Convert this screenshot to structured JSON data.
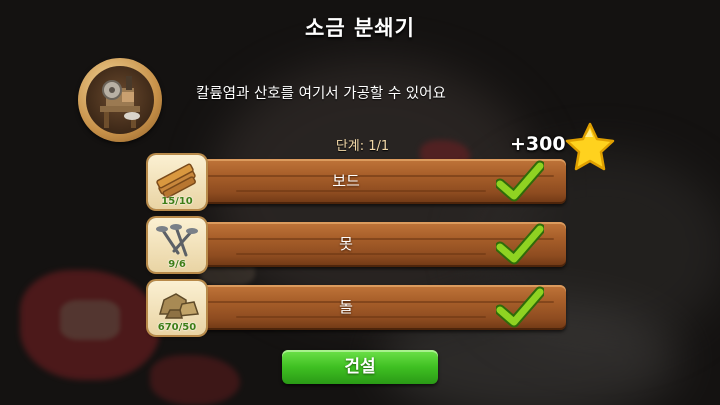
{
  "dialog": {
    "title": "소금 분쇄기",
    "description": "칼륨염과 산호를 여기서 가공할 수 있어요",
    "stage_label": "단계: 1/1",
    "reward": "+300",
    "reward_icon": "star-icon",
    "building_icon": "salt-grinder-icon"
  },
  "requirements": [
    {
      "name": "보드",
      "count": "15/10",
      "icon": "wood-boards-icon",
      "completed": true
    },
    {
      "name": "못",
      "count": "9/6",
      "icon": "nails-icon",
      "completed": true
    },
    {
      "name": "돌",
      "count": "670/50",
      "icon": "stones-icon",
      "completed": true
    }
  ],
  "build_button": {
    "label": "건설",
    "color": "#3fc022"
  },
  "colors": {
    "check": "#8fd322",
    "count_text": "#3e7d15",
    "star": "#ffd21e"
  }
}
